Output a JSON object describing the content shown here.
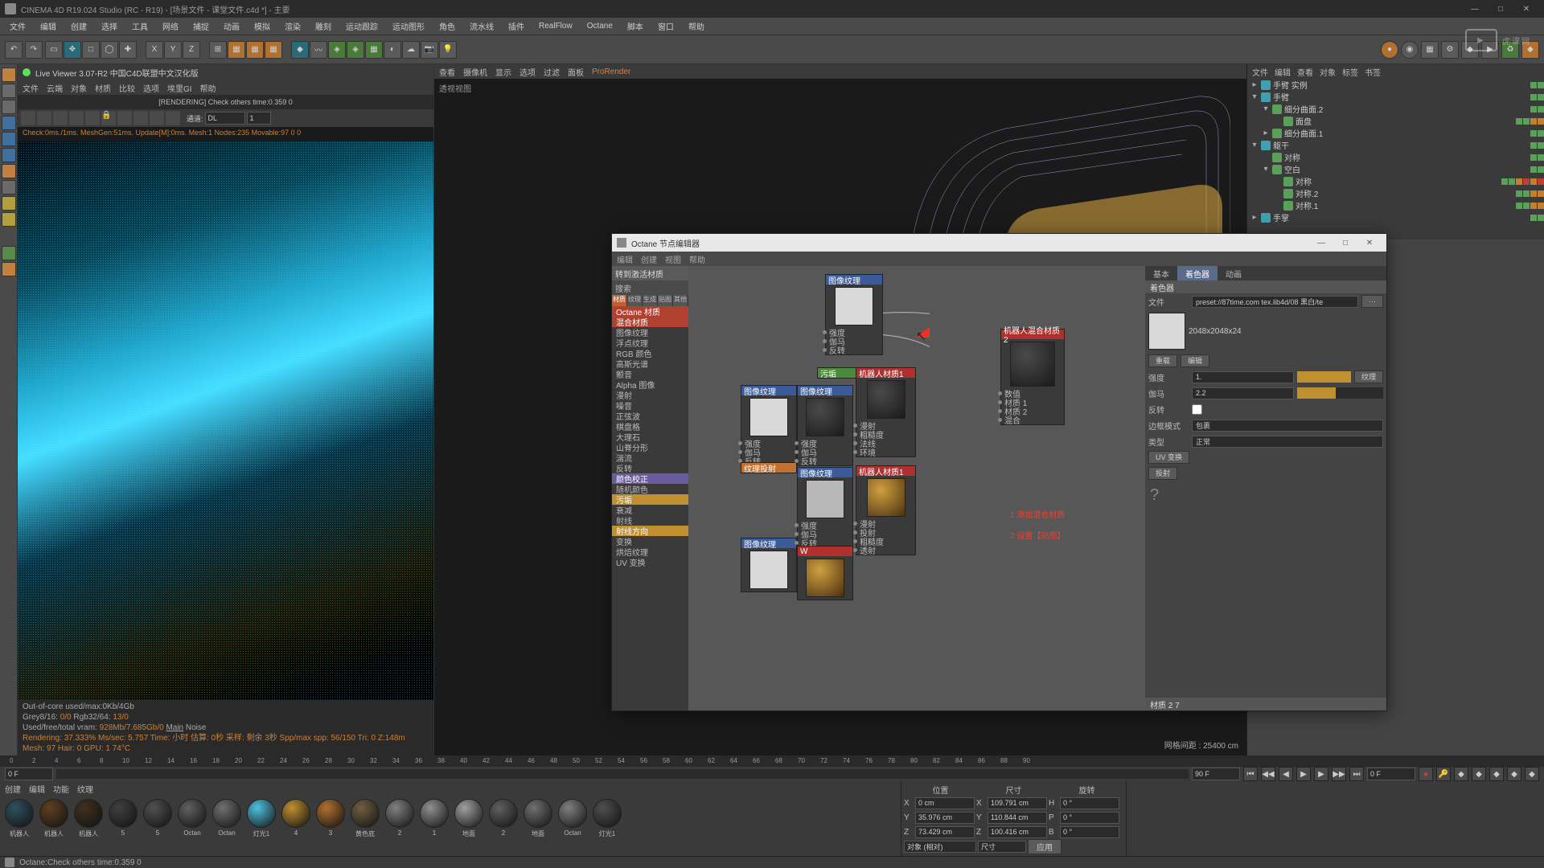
{
  "window": {
    "title": "CINEMA 4D R19.024 Studio (RC - R19) - [场景文件 - 课堂文件.c4d *] - 主要"
  },
  "menubar": [
    "文件",
    "编辑",
    "创建",
    "选择",
    "工具",
    "网络",
    "捕捉",
    "动画",
    "模拟",
    "渲染",
    "雕刻",
    "运动跟踪",
    "运动图形",
    "角色",
    "流水线",
    "插件",
    "RealFlow",
    "Octane",
    "脚本",
    "窗口",
    "帮助"
  ],
  "liveviewer": {
    "title": "Live Viewer 3.07-R2 中国C4D联盟中文汉化版",
    "menu": [
      "文件",
      "云端",
      "对象",
      "材质",
      "比较",
      "选项",
      "埃里GI",
      "帮助"
    ],
    "status": "[RENDERING] Check others time:0.359  0",
    "mode_label": "通道:",
    "mode_value": "DL",
    "num": "1",
    "info": "Check:0ms./1ms. MeshGen:51ms. Update[M]:0ms. Mesh:1 Nodes:235 Movable:97  0  0",
    "foot1": "Out-of-core used/max:0Kb/4Gb",
    "foot2a": "Grey8/16: ",
    "foot2b": "0/0",
    "foot2c": "     Rgb32/64: ",
    "foot2d": "13/0",
    "foot3a": "Used/free/total vram: ",
    "foot3b": "928Mb/7.685Gb/0",
    "foot3c": "   ",
    "foot3d": "Main",
    "foot3e": " Noise",
    "foot4": "Rendering: 37.333%   Ms/sec: 5.757   Time: 小时   估算: 0秒   采样: 剩余 3秒   Spp/max spp: 56/150   Tri: 0   Z:148m   Mesh: 97   Hair: 0   GPU: 1   74°C"
  },
  "viewport": {
    "menu": [
      "查看",
      "摄像机",
      "显示",
      "选项",
      "过滤",
      "面板",
      "ProRender"
    ],
    "label": "透视视图",
    "coord": "网格间距 : 25400 cm"
  },
  "objtree": {
    "menu": [
      "文件",
      "编辑",
      "查看",
      "对象",
      "标签",
      "书签"
    ],
    "rows": [
      {
        "ind": 0,
        "exp": "▸",
        "name": "手臂 实例",
        "flags": [
          "g",
          "g"
        ]
      },
      {
        "ind": 0,
        "exp": "▾",
        "name": "手臂",
        "flags": [
          "g",
          "g"
        ]
      },
      {
        "ind": 1,
        "exp": "▾",
        "name": "细分曲面.2",
        "flags": [
          "g",
          "g"
        ]
      },
      {
        "ind": 2,
        "exp": "",
        "name": "面盘",
        "flags": [
          "g",
          "g",
          "o",
          "o"
        ]
      },
      {
        "ind": 1,
        "exp": "▸",
        "name": "细分曲面.1",
        "flags": [
          "g",
          "g"
        ]
      },
      {
        "ind": 0,
        "exp": "▾",
        "name": "躯干",
        "flags": [
          "g",
          "g"
        ]
      },
      {
        "ind": 1,
        "exp": "",
        "name": "对称",
        "flags": [
          "g",
          "g"
        ]
      },
      {
        "ind": 1,
        "exp": "▾",
        "name": "空白",
        "flags": [
          "g",
          "g"
        ]
      },
      {
        "ind": 2,
        "exp": "",
        "name": "对称",
        "flags": [
          "g",
          "g",
          "o",
          "r",
          "o",
          "r"
        ]
      },
      {
        "ind": 2,
        "exp": "",
        "name": "对称.2",
        "flags": [
          "g",
          "g",
          "o",
          "o"
        ]
      },
      {
        "ind": 2,
        "exp": "",
        "name": "对称.1",
        "flags": [
          "g",
          "g",
          "o",
          "o"
        ]
      },
      {
        "ind": 0,
        "exp": "▸",
        "name": "手掌",
        "flags": [
          "g",
          "g"
        ]
      }
    ]
  },
  "octdlg": {
    "title": "Octane 节点编辑器",
    "menu": [
      "编辑",
      "创建",
      "视图",
      "帮助"
    ],
    "btn_active": "转到激活材质",
    "btn_search": "搜索",
    "tabs": [
      "材质",
      "纹理",
      "生成",
      "贴图",
      "其他"
    ],
    "list": [
      "Octane 材质",
      "混合材质",
      "图像纹理",
      "浮点纹理",
      "RGB 颜色",
      "高斯光谱",
      "颤音",
      "Alpha 图像",
      "漫射",
      "噪音",
      "正弦波",
      "棋盘格",
      "大理石",
      "山脊分形",
      "湍流",
      "反转",
      "颜色校正",
      "随机颜色",
      "污垢",
      "衰减",
      "射线",
      "射线方向",
      "变换",
      "烘焙纹理",
      "UV 变换"
    ],
    "nodes": {
      "imgtex1": "图像纹理",
      "imgtex2": "图像纹理",
      "imgtex3": "图像纹理",
      "imgtex4": "图像纹理",
      "oct1": "机器人材质1",
      "oct2": "机器人混合材质2",
      "dirt": "污垢",
      "texproj": "纹理投射",
      "w": "W"
    },
    "ports": [
      "强度",
      "伽马",
      "反转",
      "漫射",
      "数值",
      "材质 1",
      "材质 2",
      "混合",
      "粗糙度",
      "法线",
      "环境",
      "投射",
      "透射"
    ],
    "annotation1": "1 添加混合材质",
    "annotation2": "2 设置【贴图】"
  },
  "attr": {
    "tabs": [
      "基本",
      "着色器",
      "动画"
    ],
    "section": "着色器",
    "file_lbl": "文件",
    "file_val": "preset://87time.com tex.lib4d/08 黑白/te",
    "size": "2048x2048x24",
    "reload": "重载",
    "edit": "编辑",
    "strength_lbl": "强度",
    "strength_val": "1.",
    "gamma_lbl": "伽马",
    "gamma_val": "2.2",
    "invert_lbl": "反转",
    "border_lbl": "边框模式",
    "border_val": "包裹",
    "type_lbl": "类型",
    "type_val": "正常",
    "uv_btn": "UV 变换",
    "proj_btn": "投射",
    "help": "?",
    "footer": "材质 2   7"
  },
  "timeline": {
    "range0": "0 F",
    "range1": "90 F",
    "fps": "0 F"
  },
  "materials": {
    "menu": [
      "创建",
      "编辑",
      "功能",
      "纹理"
    ],
    "items": [
      "机器人",
      "机器人",
      "机器人",
      "5",
      "5",
      "Octan",
      "Octan",
      "灯光1",
      "4",
      "3",
      "黄色底",
      "2",
      "1",
      "地面",
      "2",
      "地面",
      "Octan",
      "灯光1"
    ]
  },
  "coord": {
    "hdr": [
      "位置",
      "尺寸",
      "旋转"
    ],
    "x": [
      "0 cm",
      "109.791 cm",
      "0 °"
    ],
    "y": [
      "35.976 cm",
      "110.844 cm",
      "0 °"
    ],
    "z": [
      "73.429 cm",
      "100.416 cm",
      "0 °"
    ],
    "mode": "对象 (相对)",
    "size": "尺寸",
    "apply": "应用"
  },
  "statusbar": "Octane:Check others time:0.359   0",
  "watermark": "虎课网"
}
